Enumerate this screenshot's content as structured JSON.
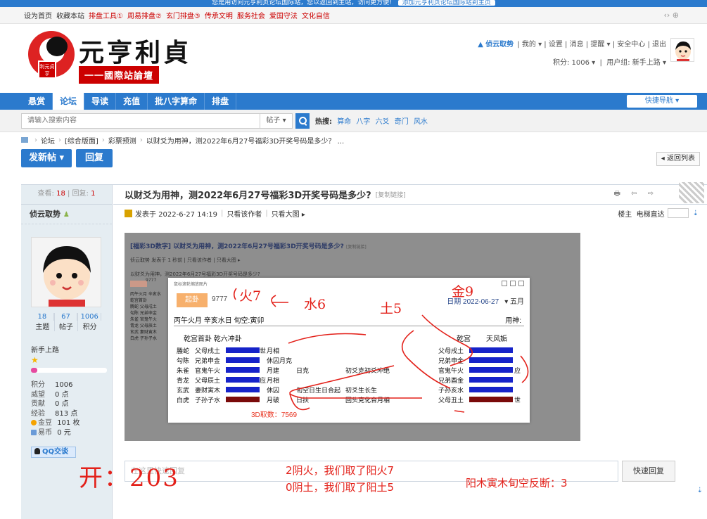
{
  "notice": {
    "text": "您是用访问元亨利贞论坛国际站，您以返回到主站，访问更方便!",
    "button": "添加元亨利贞论坛国际站到主页"
  },
  "topbar": {
    "items": [
      "设为首页",
      "收藏本站"
    ],
    "links": [
      "排盘工具①",
      "周易排盘②",
      "玄门排盘③",
      "传承文明",
      "服务社会",
      "爱国守法",
      "文化自信"
    ],
    "right": "‹› ⊕"
  },
  "header": {
    "logo_title": "元亨利貞",
    "logo_sub": "一一國際站論壇",
    "logo_stamp": "利元貞亨",
    "user": "侦云取势",
    "links": [
      "我的 ▾",
      "设置",
      "消息",
      "提醒 ▾",
      "安全中心",
      "退出"
    ],
    "score": "积分: 1006 ▾",
    "group": "用户组: 新手上路 ▾"
  },
  "nav": {
    "items": [
      "悬赏",
      "论坛",
      "导读",
      "充值",
      "批八字算命",
      "排盘"
    ],
    "quick": "快捷导航 ▾"
  },
  "search": {
    "placeholder": "请输入搜索内容",
    "type": "帖子 ▾",
    "hot_label": "热搜:",
    "hot": [
      "算命",
      "八字",
      "六爻",
      "奇门",
      "风水"
    ]
  },
  "breadcrumb": [
    "论坛",
    "[综合版面]",
    "彩票预测",
    "以财爻为用神，测2022年6月27号福彩3D开奖号码是多少？ ..."
  ],
  "actions": {
    "new_post": "发新帖 ▾",
    "reply": "回复",
    "back": "◂ 返回列表"
  },
  "sidebar": {
    "views_label": "查看:",
    "views": "18",
    "replies_label": "回复:",
    "replies": "1",
    "username": "侦云取势",
    "counts": [
      {
        "n": "18",
        "l": "主题"
      },
      {
        "n": "67",
        "l": "帖子"
      },
      {
        "n": "1006",
        "l": "积分"
      }
    ],
    "group": "新手上路",
    "star": "★",
    "progress": 0.08,
    "info": [
      {
        "k": "积分",
        "v": "1006"
      },
      {
        "k": "威望",
        "v": "0 点"
      },
      {
        "k": "贡献",
        "v": "0 点"
      },
      {
        "k": "经验",
        "v": "813 点"
      },
      {
        "k": "金豆",
        "v": "101 枚"
      },
      {
        "k": "易币",
        "v": "0 元"
      }
    ],
    "qq": "QQ交谈"
  },
  "post": {
    "title": "以财爻为用神，测2022年6月27号福彩3D开奖号码是多少?",
    "copy": "[复制链接]",
    "icons": "🖶 ⇦ ⇨",
    "meta": {
      "posted": "发表于 2022-6-27 14:19",
      "only_author": "只看该作者",
      "only_big": "只看大图 ▸",
      "floor": "楼主",
      "elevator": "电梯直达",
      "arrow": "⇣"
    }
  },
  "shot": {
    "title": "[福彩3D数字] 以财爻为用神，测2022年6月27号福彩3D开奖号码是多少?",
    "copy": "[复制链接]",
    "meta": "侦云取势 发表于 1 秒前  |  只看该作者  |  只看大图 ▸",
    "line": "以财爻为用神，测2022年6月27号福彩3D开奖号码是多少?",
    "mini_num": "9777",
    "mini_rows": [
      "丙午火月 辛亥水",
      "乾宫首卦",
      "腾蛇 父母戌土",
      "勾陈 兄弟申金",
      "朱雀 官鬼午火",
      "青龙 父母辰土",
      "玄武 妻财寅木",
      "白虎 子孙子水"
    ]
  },
  "popup": {
    "header": "鼠标滚轮缩放图片",
    "btn": "起卦",
    "num": "9777",
    "date_label": "日期",
    "date": "2022-06-27",
    "month": "▾ 五月",
    "ganzhi": "丙午火月 辛亥水日 旬空:寅卯",
    "yongshen": "用神:",
    "left_gua": "乾宫首卦 乾六冲卦",
    "right_gua_a": "乾宫",
    "right_gua_b": "天风姤",
    "rows": [
      {
        "god": "螣蛇",
        "yao": "父母戌土",
        "type": "yang",
        "shi": "世",
        "note": "月相",
        "extra": "",
        "extra2": "",
        "rname": "父母戌土",
        "rtype": "yang",
        "rmark": ""
      },
      {
        "god": "勾陈",
        "yao": "兄弟申金",
        "type": "yang",
        "shi": "",
        "note": "休囚月克",
        "extra": "",
        "extra2": "",
        "rname": "兄弟申金",
        "rtype": "yang",
        "rmark": ""
      },
      {
        "god": "朱雀",
        "yao": "官鬼午火",
        "type": "yang",
        "shi": "",
        "note": "月建",
        "extra": "日克",
        "extra2": "初爻克初爻冲绝",
        "rname": "官鬼午火",
        "rtype": "yang",
        "rmark": "应"
      },
      {
        "god": "青龙",
        "yao": "父母辰土",
        "type": "yang",
        "shi": "应",
        "note": "月相",
        "extra": "",
        "extra2": "",
        "rname": "兄弟酉金",
        "rtype": "yang",
        "rmark": ""
      },
      {
        "god": "玄武",
        "yao": "妻财寅木",
        "type": "yang",
        "shi": "",
        "note": "休囚",
        "extra": "旬空日生日合起",
        "extra2": "初爻生长生",
        "rname": "子孙亥水",
        "rtype": "yang",
        "rmark": ""
      },
      {
        "god": "白虎",
        "yao": "子孙子水",
        "type": "yin",
        "shi": "",
        "note": "月破",
        "extra": "日扶",
        "extra2": "回头克化合月相",
        "rname": "父母丑土",
        "rtype": "yin",
        "rmark": "世"
      }
    ],
    "zr": "3D取数：7569"
  },
  "reply": {
    "placeholder": "在这里快速回复",
    "button": "快速回复"
  },
  "annotations": {
    "huo": "火7",
    "shui": "水6",
    "tu": "土5",
    "jin": "金9",
    "yang_huo_1": "2阴火，我们取了阳火7",
    "yang_tu": "0阴土，我们取了阳土5",
    "yin_mu": "阳木寅木旬空反断：3",
    "kai": "开：203"
  },
  "colors": {
    "primary": "#2b7acd",
    "accent_red": "#e3211a",
    "yang_bar": "#1623c9",
    "yin_bar": "#7a0a0a"
  }
}
